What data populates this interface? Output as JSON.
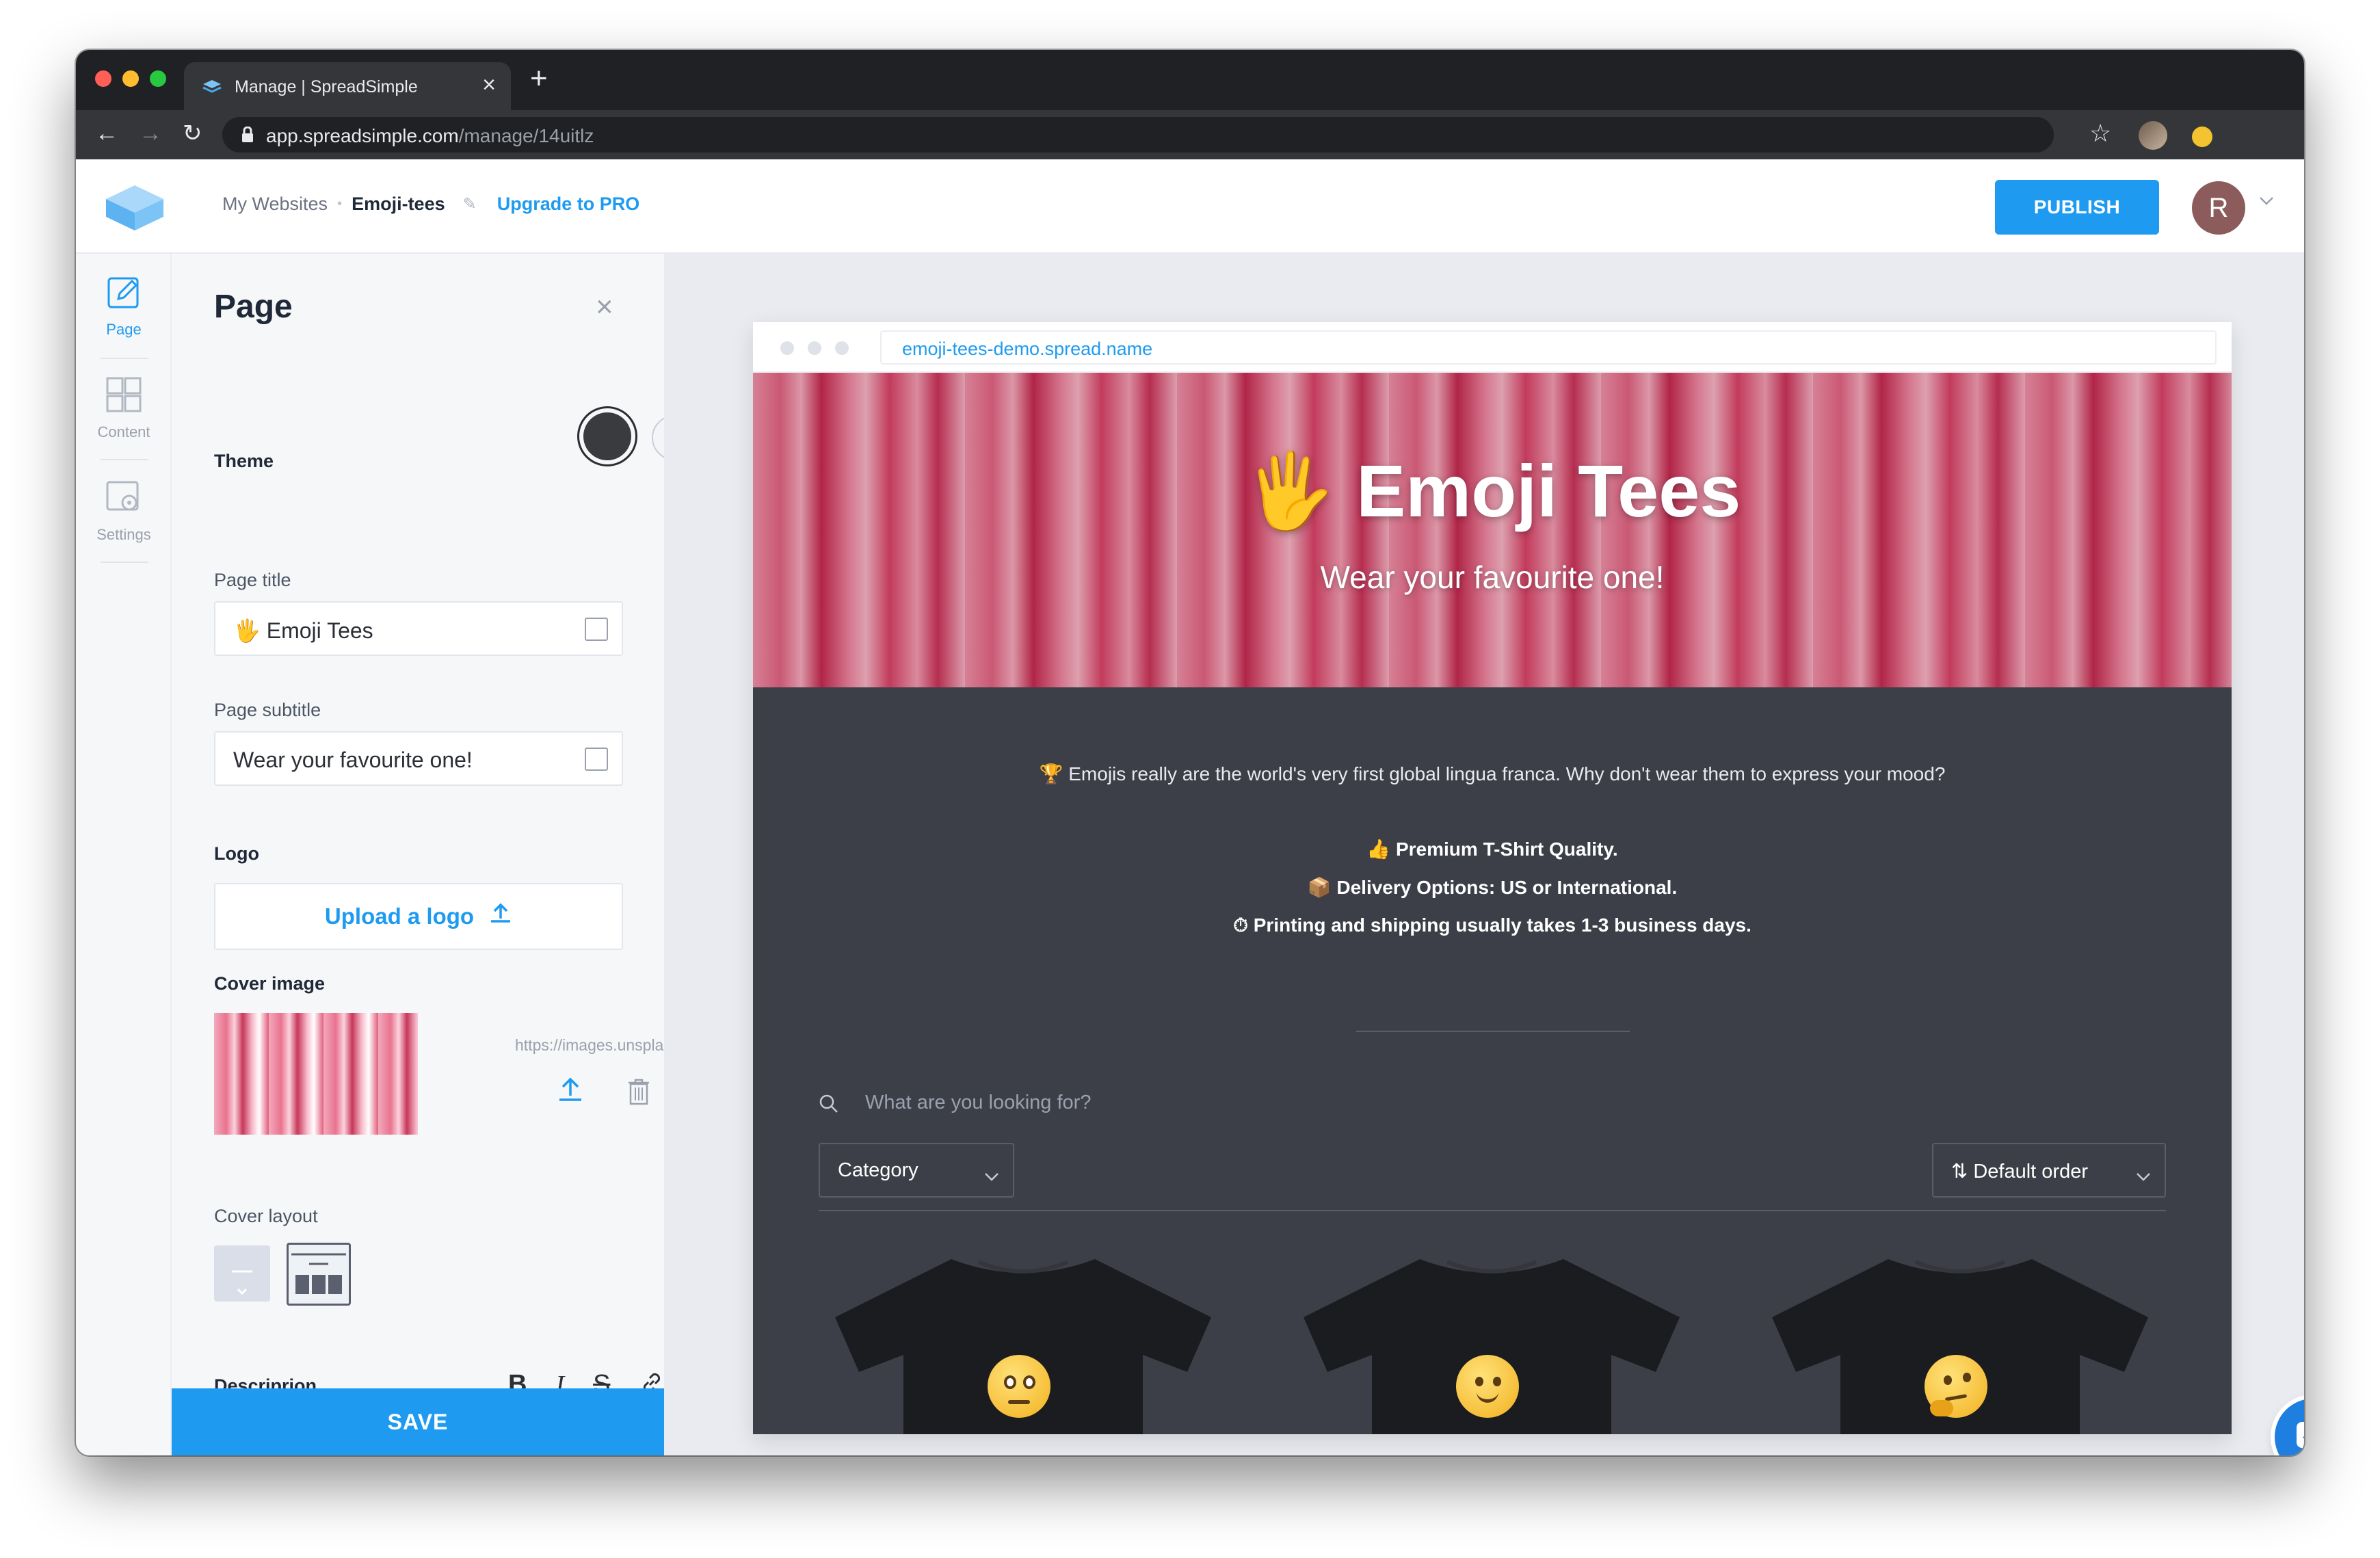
{
  "browser": {
    "tab_title": "Manage | SpreadSimple",
    "url_host": "app.spreadsimple.com",
    "url_path": "/manage/14uitlz"
  },
  "header": {
    "crumb_websites": "My Websites",
    "crumb_current": "Emoji-tees",
    "upgrade_label": "Upgrade to PRO",
    "publish_label": "PUBLISH",
    "avatar_initial": "R"
  },
  "rail": {
    "items": [
      {
        "label": "Page",
        "icon": "pencil-icon",
        "active": true
      },
      {
        "label": "Content",
        "icon": "grid-icon",
        "active": false
      },
      {
        "label": "Settings",
        "icon": "settings-icon",
        "active": false
      }
    ]
  },
  "panel": {
    "title": "Page",
    "theme_label": "Theme",
    "page_title_label": "Page title",
    "page_title_value": "🖐 Emoji Tees",
    "page_subtitle_label": "Page subtitle",
    "page_subtitle_value": "Wear your favourite one!",
    "logo_label": "Logo",
    "upload_logo_label": "Upload a logo",
    "cover_image_label": "Cover image",
    "cover_image_url": "https://images.unspla...",
    "cover_layout_label": "Cover layout",
    "description_label": "Descriprion",
    "toolbar": {
      "bold": "B",
      "italic": "I",
      "strike": "S"
    },
    "save_label": "SAVE"
  },
  "preview": {
    "url": "emoji-tees-demo.spread.name",
    "hero_title": "🖐 Emoji Tees",
    "hero_subtitle": "Wear your favourite one!",
    "intro": "🏆 Emojis really are the world's very first global lingua franca. Why don't wear them to express your mood?",
    "features": [
      "👍 Premium T-Shirt Quality.",
      "📦 Delivery Options: US or International.",
      "⏱ Printing and shipping usually takes 1-3 business days."
    ],
    "search_placeholder": "What are you looking for?",
    "category_label": "Category",
    "sort_label": "⇅ Default order"
  },
  "colors": {
    "accent": "#1e9bf0",
    "preview_bg": "#3c3f48",
    "chrome_dark": "#202124"
  }
}
